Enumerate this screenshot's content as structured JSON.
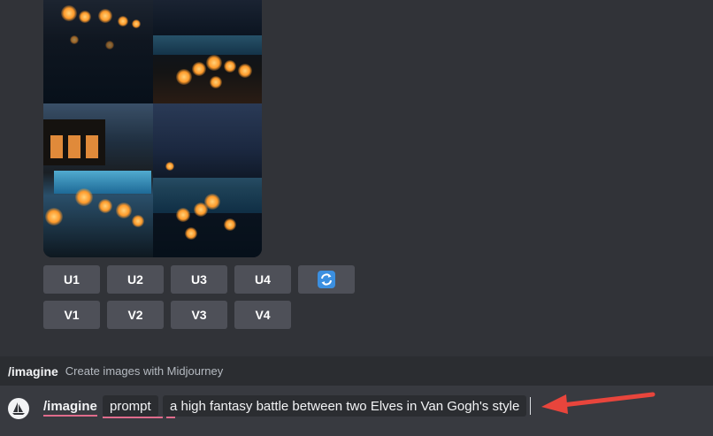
{
  "image_grid": {
    "alt": "Four generated images of candles around a pool at night"
  },
  "upscale_buttons": [
    "U1",
    "U2",
    "U3",
    "U4"
  ],
  "variation_buttons": [
    "V1",
    "V2",
    "V3",
    "V4"
  ],
  "reroll_icon": "refresh-icon",
  "suggestion": {
    "command": "/imagine",
    "description": "Create images with Midjourney"
  },
  "input": {
    "command": "/imagine",
    "param_name": "prompt",
    "param_value": "a high fantasy battle between two Elves in Van Gogh's style"
  },
  "colors": {
    "background": "#313338",
    "button": "#4e5058",
    "underline": "#e06c8c",
    "arrow": "#e8453c",
    "reroll": "#3b8fe0"
  }
}
